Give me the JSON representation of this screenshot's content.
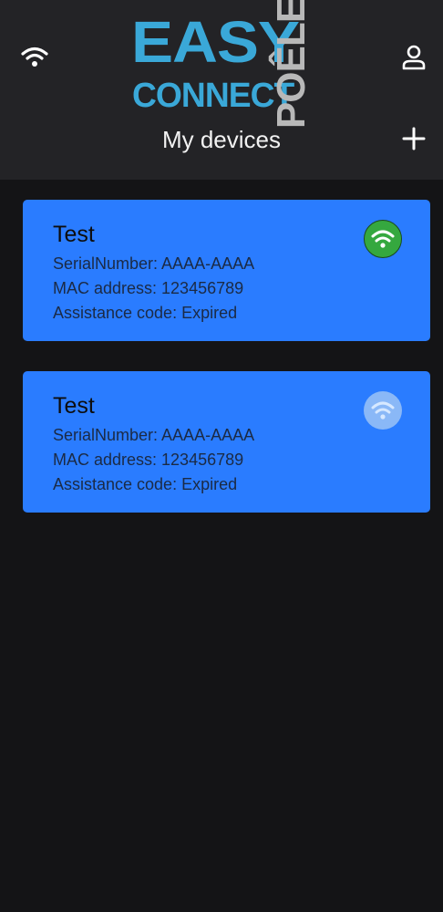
{
  "header": {
    "logo_line1": "EASY",
    "logo_line2": "CONNECT",
    "logo_vertical": "POÊLE",
    "title": "My devices"
  },
  "icons": {
    "status": "wifi-icon",
    "account": "user-icon",
    "add": "plus-icon"
  },
  "colors": {
    "card": "#2a7cff",
    "online": "#35a83f",
    "offline": "#8ab8f7",
    "logo": "#3aa8d8"
  },
  "devices": [
    {
      "name": "Test",
      "serial": "SerialNumber: AAAA-AAAA",
      "mac": "MAC address: 123456789",
      "assistance": "Assistance code: Expired",
      "status": "online"
    },
    {
      "name": "Test",
      "serial": "SerialNumber: AAAA-AAAA",
      "mac": "MAC address: 123456789",
      "assistance": "Assistance code: Expired",
      "status": "offline"
    }
  ]
}
